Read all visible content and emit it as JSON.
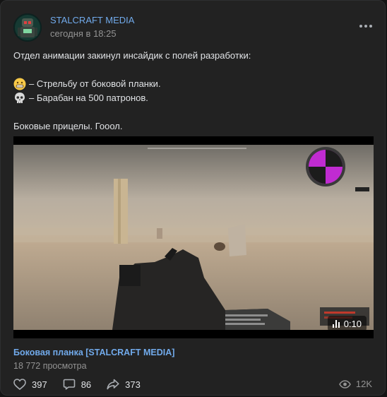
{
  "post": {
    "author": "STALCRAFT MEDIA",
    "date": "сегодня в 18:25",
    "lines": [
      "Отдел анимации закинул инсайдик с полей разработки:",
      "– Стрельбу от боковой планки.",
      "– Барабан на 500 патронов.",
      "Боковые прицелы. Гооол."
    ],
    "emoji": [
      "grimacing-face",
      "skull"
    ]
  },
  "video": {
    "duration": "0:10",
    "title": "Боковая планка [STALCRAFT MEDIA]",
    "views": "18 772 просмотра"
  },
  "stats": {
    "likes": "397",
    "comments": "86",
    "shares": "373",
    "views": "12K"
  },
  "colors": {
    "link": "#71aaeb",
    "card_bg": "#222222",
    "page_bg": "#141414",
    "muted": "#939393",
    "minimap": "#c02bd1"
  },
  "icons": [
    "more-icon",
    "heart-icon",
    "comment-icon",
    "share-icon",
    "eye-icon",
    "video-bars-icon"
  ]
}
